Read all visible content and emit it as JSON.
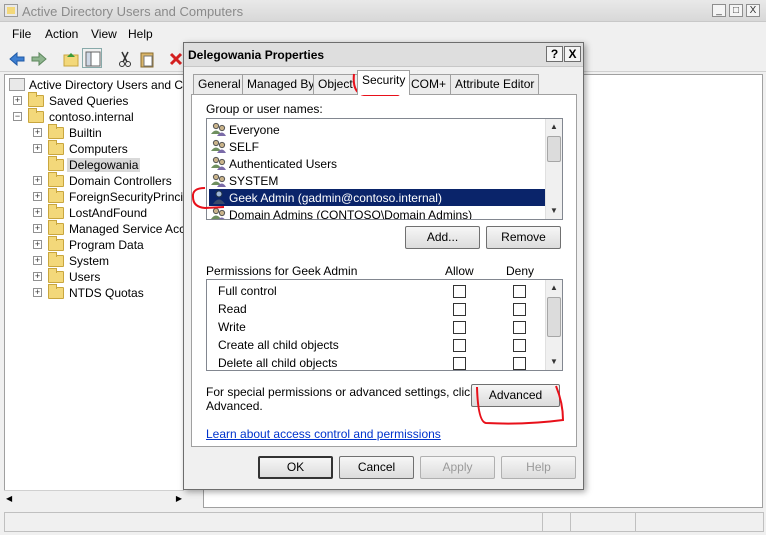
{
  "window": {
    "title": "Active Directory Users and Computers",
    "controls": [
      "_",
      "□",
      "X"
    ]
  },
  "menu": [
    "File",
    "Action",
    "View",
    "Help"
  ],
  "tree": {
    "root": "Active Directory Users and Com",
    "items": [
      {
        "label": "Saved Queries",
        "level": 1,
        "expander": "+"
      },
      {
        "label": "contoso.internal",
        "level": 1,
        "expander": "−"
      },
      {
        "label": "Builtin",
        "level": 2,
        "expander": "+"
      },
      {
        "label": "Computers",
        "level": 2,
        "expander": "+"
      },
      {
        "label": "Delegowania",
        "level": 2,
        "expander": ""
      },
      {
        "label": "Domain Controllers",
        "level": 2,
        "expander": "+"
      },
      {
        "label": "ForeignSecurityPrincipal",
        "level": 2,
        "expander": "+"
      },
      {
        "label": "LostAndFound",
        "level": 2,
        "expander": "+"
      },
      {
        "label": "Managed Service Accou",
        "level": 2,
        "expander": "+"
      },
      {
        "label": "Program Data",
        "level": 2,
        "expander": "+"
      },
      {
        "label": "System",
        "level": 2,
        "expander": "+"
      },
      {
        "label": "Users",
        "level": 2,
        "expander": "+"
      },
      {
        "label": "NTDS Quotas",
        "level": 2,
        "expander": "+"
      }
    ]
  },
  "dialog": {
    "title": "Delegowania Properties",
    "help_btn": "?",
    "close_btn": "X",
    "tabs": [
      "General",
      "Managed By",
      "Object",
      "Security",
      "COM+",
      "Attribute Editor"
    ],
    "group_label": "Group or user names:",
    "users": [
      {
        "name": "Everyone",
        "icon": "group-icon"
      },
      {
        "name": "SELF",
        "icon": "group-icon"
      },
      {
        "name": "Authenticated Users",
        "icon": "group-icon"
      },
      {
        "name": "SYSTEM",
        "icon": "group-icon"
      },
      {
        "name": "Geek Admin (gadmin@contoso.internal)",
        "icon": "user-icon"
      },
      {
        "name": "Domain Admins (CONTOSO\\Domain Admins)",
        "icon": "group-icon"
      }
    ],
    "add_btn": "Add...",
    "remove_btn": "Remove",
    "perm_label": "Permissions for Geek Admin",
    "allow_label": "Allow",
    "deny_label": "Deny",
    "permissions": [
      "Full control",
      "Read",
      "Write",
      "Create all child objects",
      "Delete all child objects"
    ],
    "special_text_1": "For special permissions or advanced settings, click",
    "special_text_2": "Advanced.",
    "advanced_btn": "Advanced",
    "link": "Learn about access control and permissions",
    "ok_btn": "OK",
    "cancel_btn": "Cancel",
    "apply_btn": "Apply",
    "help_bottom_btn": "Help"
  },
  "colors": {
    "selection": "#0a246a",
    "annotation": "#e8101a",
    "link": "#0033cc"
  }
}
